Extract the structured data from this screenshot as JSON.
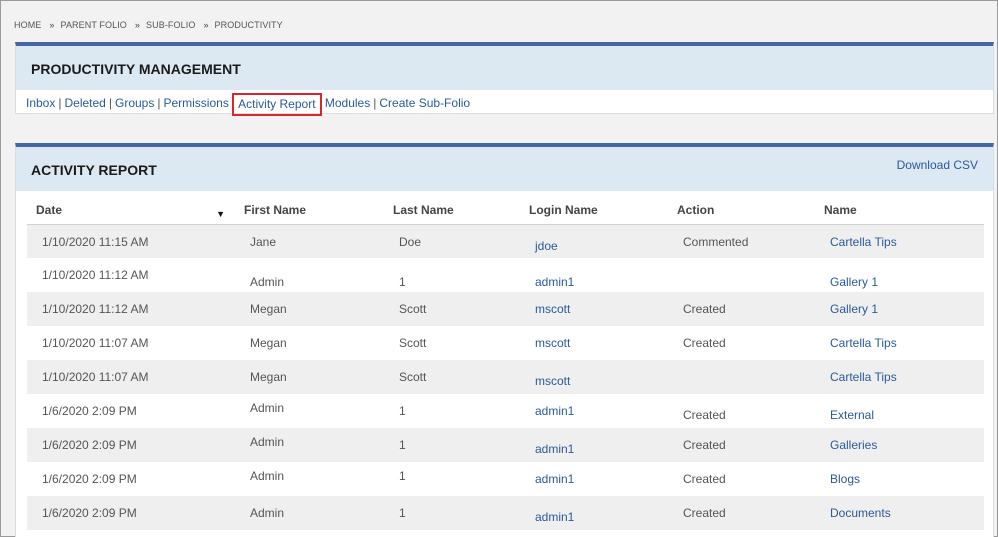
{
  "breadcrumb": [
    "HOME",
    "PARENT FOLIO",
    "SUB-FOLIO",
    "PRODUCTIVITY"
  ],
  "breadcrumb_sep": "»",
  "management": {
    "title": "PRODUCTIVITY MANAGEMENT",
    "links": [
      "Inbox",
      "Deleted",
      "Groups",
      "Permissions",
      "Activity Report",
      "Modules",
      "Create Sub-Folio"
    ],
    "highlighted": "Activity Report",
    "sep": "|"
  },
  "report": {
    "title": "ACTIVITY REPORT",
    "download_label": "Download CSV",
    "sort_indicator": "▼",
    "columns": [
      "Date",
      "First Name",
      "Last Name",
      "Login Name",
      "Action",
      "Name"
    ],
    "rows": [
      {
        "date": "1/10/2020 11:15 AM",
        "first": "Jane",
        "last": "Doe",
        "login": "jdoe",
        "action": "Commented",
        "name": "Cartella Tips"
      },
      {
        "date": "1/10/2020 11:12 AM",
        "first": "Admin",
        "last": "1",
        "login": "admin1",
        "action": "",
        "name": "Gallery 1"
      },
      {
        "date": "1/10/2020 11:12 AM",
        "first": "Megan",
        "last": "Scott",
        "login": "mscott",
        "action": "Created",
        "name": "Gallery 1"
      },
      {
        "date": "1/10/2020 11:07 AM",
        "first": "Megan",
        "last": "Scott",
        "login": "mscott",
        "action": "Created",
        "name": "Cartella Tips"
      },
      {
        "date": "1/10/2020 11:07 AM",
        "first": "Megan",
        "last": "Scott",
        "login": "mscott",
        "action": "",
        "name": "Cartella Tips"
      },
      {
        "date": "1/6/2020 2:09 PM",
        "first": "Admin",
        "last": "1",
        "login": "admin1",
        "action": "Created",
        "name": "External"
      },
      {
        "date": "1/6/2020 2:09 PM",
        "first": "Admin",
        "last": "1",
        "login": "admin1",
        "action": "Created",
        "name": "Galleries"
      },
      {
        "date": "1/6/2020 2:09 PM",
        "first": "Admin",
        "last": "1",
        "login": "admin1",
        "action": "Created",
        "name": "Blogs"
      },
      {
        "date": "1/6/2020 2:09 PM",
        "first": "Admin",
        "last": "1",
        "login": "admin1",
        "action": "Created",
        "name": "Documents"
      }
    ]
  }
}
